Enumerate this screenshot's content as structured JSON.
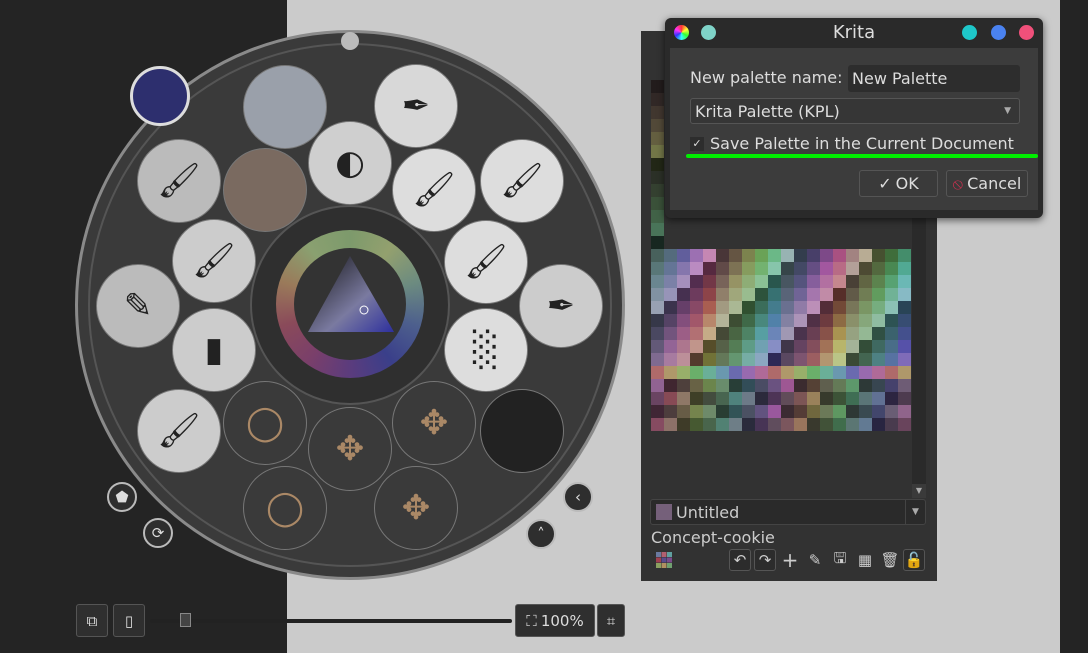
{
  "colors": {
    "accent_green": "#00ee00",
    "foreground": "#2d2f6e",
    "background": "#eeeeee"
  },
  "popup": {
    "brushes": [
      "ink-pen",
      "blender-smudge",
      "airbrush",
      "watercolor-brush",
      "texture-stamp",
      "flat-brush-blue",
      "flat-brush-blue-2",
      "water-brush",
      "ink-brush",
      "pencil-dark",
      "fineliner",
      "flat-bristle",
      "chalk-texture",
      "fan-brush",
      "ring-pattern",
      "arrow-pattern",
      "arrow-pattern-2",
      "dark-smudge",
      "ring-pattern-2",
      "arrow-pattern-3"
    ],
    "tag_icon": "tag-icon",
    "refresh_icon": "refresh-icon",
    "prev_icon": "chevron-left-icon",
    "up_icon": "chevron-up-icon"
  },
  "bottombar": {
    "zoom": "100%"
  },
  "docker": {
    "palette_combo": "Untitled",
    "palette_name": "Concept-cookie",
    "tools": [
      "undo-icon",
      "redo-icon",
      "add-icon",
      "edit-icon",
      "save-icon",
      "grid-icon",
      "delete-icon",
      "lock-icon"
    ]
  },
  "dialog": {
    "title": "Krita",
    "name_label": "New palette name:",
    "name_value": "New Palette",
    "format": "Krita Palette (KPL)",
    "save_in_document": "Save Palette in the Current Document",
    "save_checked": true,
    "ok": "OK",
    "cancel": "Cancel"
  }
}
